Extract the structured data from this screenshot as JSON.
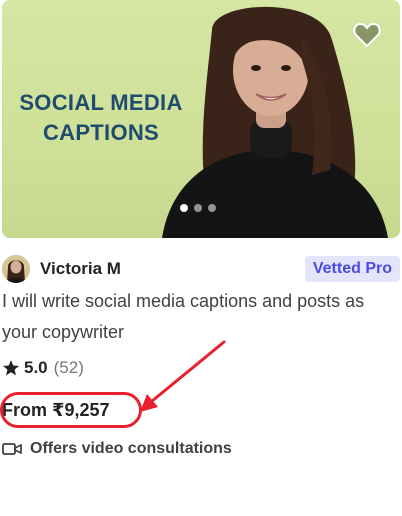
{
  "gig": {
    "image_text": {
      "line1": "SOCIAL MEDIA",
      "line2": "CAPTIONS"
    },
    "favorite_icon": "heart-icon",
    "carousel": {
      "count": 3,
      "active_index": 0
    },
    "seller": {
      "name": "Victoria M",
      "badge": "Vetted Pro"
    },
    "title": "I will write social media captions and posts as your copywriter",
    "rating": {
      "score": "5.0",
      "count": "(52)",
      "icon": "star-icon"
    },
    "price": "From ₹9,257",
    "video_consultation": {
      "label": "Offers video consultations",
      "icon": "video-camera-icon"
    }
  },
  "colors": {
    "image_bg": "#cfe098",
    "headline": "#1f4b6e",
    "badge_bg": "#e4e4fb",
    "badge_text": "#4b4be0",
    "annotation": "#e8202e"
  }
}
